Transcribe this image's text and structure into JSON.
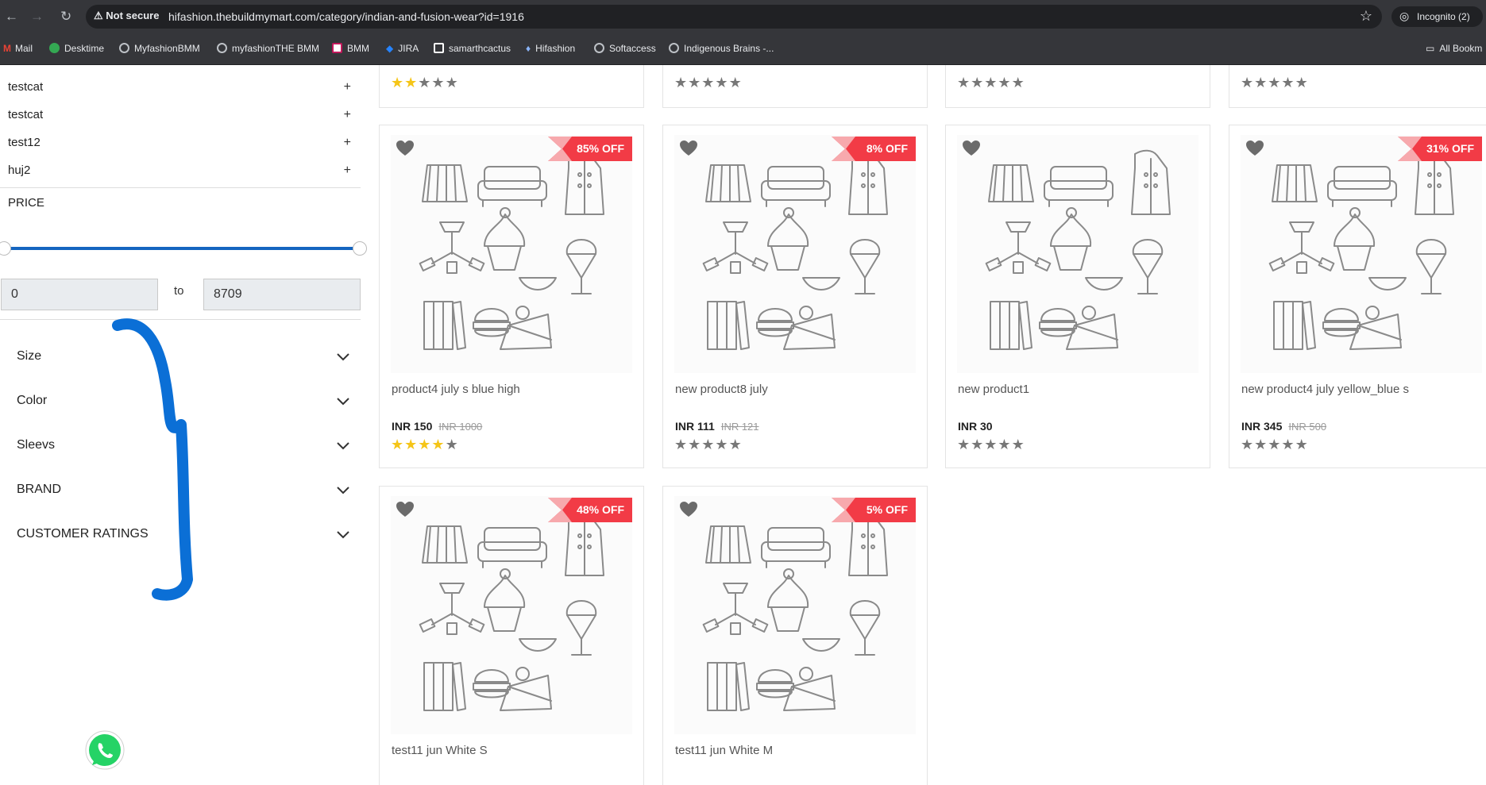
{
  "browser": {
    "not_secure": "Not secure",
    "url": "hifashion.thebuildmymart.com/category/indian-and-fusion-wear?id=1916",
    "incognito": "Incognito (2)",
    "bookmarks": [
      "Mail",
      "Desktime",
      "MyfashionBMM",
      "myfashionTHE BMM",
      "BMM",
      "JIRA",
      "samarthcactus",
      "Hifashion",
      "Softaccess",
      "Indigenous Brains -...",
      "All Bookm"
    ]
  },
  "sidebar": {
    "categories": [
      {
        "label": "testcat",
        "toggle": "+"
      },
      {
        "label": "testcat",
        "toggle": "+"
      },
      {
        "label": "test12",
        "toggle": "+"
      },
      {
        "label": "huj2",
        "toggle": "+"
      }
    ],
    "price": {
      "title": "PRICE",
      "min": "0",
      "max": "8709",
      "to": "to",
      "range_fraction": [
        0,
        1
      ]
    },
    "filters": [
      "Size",
      "Color",
      "Sleevs",
      "BRAND",
      "CUSTOMER RATINGS"
    ]
  },
  "products": {
    "top_row_ratings": [
      2,
      0,
      0,
      0
    ],
    "cards": [
      {
        "name": "product4 july s blue high",
        "price": "INR 150",
        "old_price": "INR 1000",
        "discount": "85% OFF",
        "rating": 4
      },
      {
        "name": "new product8 july",
        "price": "INR 111",
        "old_price": "INR 121",
        "discount": "8% OFF",
        "rating": 0
      },
      {
        "name": "new product1",
        "price": "INR 30",
        "old_price": "",
        "discount": "",
        "rating": 0
      },
      {
        "name": "new product4 july yellow_blue s",
        "price": "INR 345",
        "old_price": "INR 500",
        "discount": "31% OFF",
        "rating": 0
      },
      {
        "name": "test11 jun White S",
        "price": "",
        "old_price": "",
        "discount": "48% OFF",
        "rating": 0
      },
      {
        "name": "test11 jun White M",
        "price": "",
        "old_price": "",
        "discount": "5% OFF",
        "rating": 0
      }
    ]
  },
  "colors": {
    "accent": "#1565c0",
    "badge": "#f23b46",
    "star": "#f5c518"
  }
}
